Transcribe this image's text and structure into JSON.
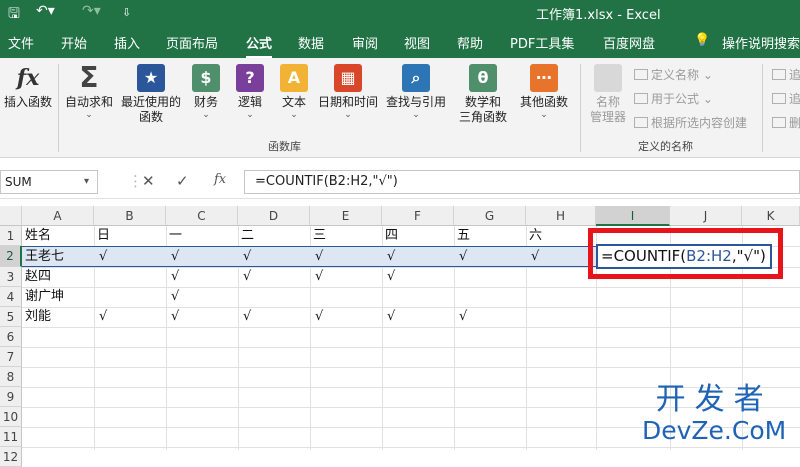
{
  "titlebar": {
    "title": "工作簿1.xlsx  -  Excel"
  },
  "tabs": [
    "文件",
    "开始",
    "插入",
    "页面布局",
    "公式",
    "数据",
    "审阅",
    "视图",
    "帮助",
    "PDF工具集",
    "百度网盘",
    "操作说明搜索"
  ],
  "active_tab": "公式",
  "ribbon": {
    "insert_function": "插入函数",
    "autosum": "自动求和",
    "recent": [
      "最近使用的",
      "函数"
    ],
    "finance": "财务",
    "logic": "逻辑",
    "text": "文本",
    "datetime": "日期和时间",
    "lookup": "查找与引用",
    "math": [
      "数学和",
      "三角函数"
    ],
    "other": "其他函数",
    "group_library": "函数库",
    "name_manager": [
      "名称",
      "管理器"
    ],
    "define_name": "定义名称",
    "use_in_formula": "用于公式",
    "create_from_selection": "根据所选内容创建",
    "group_defined_names": "定义的名称",
    "tail": [
      "追",
      "追",
      "删"
    ]
  },
  "formula_bar": {
    "name_box": "SUM",
    "formula": "=COUNTIF(B2:H2,\"√\")"
  },
  "grid": {
    "columns": [
      "A",
      "B",
      "C",
      "D",
      "E",
      "F",
      "G",
      "H",
      "I",
      "J",
      "K"
    ],
    "rows": [
      "1",
      "2",
      "3",
      "4",
      "5",
      "6",
      "7",
      "8",
      "9",
      "10",
      "11",
      "12"
    ],
    "header_row": [
      "姓名",
      "日",
      "一",
      "二",
      "三",
      "四",
      "五",
      "六"
    ],
    "names": [
      "王老七",
      "赵四",
      "谢广坤",
      "刘能"
    ],
    "check": "√",
    "edit": {
      "prefix": "=COUNTIF(",
      "ref": "B2:H2",
      "suffix": ",\"√\")"
    }
  },
  "watermark": {
    "cn": "开发者",
    "en": "DevZe.CoM"
  }
}
